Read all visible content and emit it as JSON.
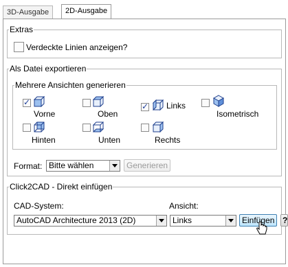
{
  "tabs": [
    {
      "label": "3D-Ausgabe",
      "active": false
    },
    {
      "label": "2D-Ausgabe",
      "active": true
    }
  ],
  "extras": {
    "legend": "Extras",
    "hidden_lines_label": "Verdeckte Linien anzeigen?",
    "hidden_lines_checked": false
  },
  "export": {
    "legend": "Als Datei exportieren",
    "views_legend": "Mehrere Ansichten generieren",
    "views": [
      {
        "label": "Vorne",
        "checked": true,
        "icon": "cube-front-icon"
      },
      {
        "label": "Oben",
        "checked": false,
        "icon": "cube-top-icon"
      },
      {
        "label": "Links",
        "checked": true,
        "icon": "cube-left-icon"
      },
      {
        "label": "Isometrisch",
        "checked": false,
        "icon": "cube-isometric-icon"
      },
      {
        "label": "Hinten",
        "checked": false,
        "icon": "cube-back-icon"
      },
      {
        "label": "Unten",
        "checked": false,
        "icon": "cube-bottom-icon"
      },
      {
        "label": "Rechts",
        "checked": false,
        "icon": "cube-right-icon"
      }
    ],
    "format_label": "Format:",
    "format_value": "Bitte wählen",
    "generate_label": "Generieren"
  },
  "click2cad": {
    "legend": "Click2CAD - Direkt einfügen",
    "cad_label": "CAD-System:",
    "cad_value": "AutoCAD Architecture 2013 (2D)",
    "view_label": "Ansicht:",
    "view_value": "Links",
    "insert_label": "Einfügen",
    "help_label": "?"
  }
}
